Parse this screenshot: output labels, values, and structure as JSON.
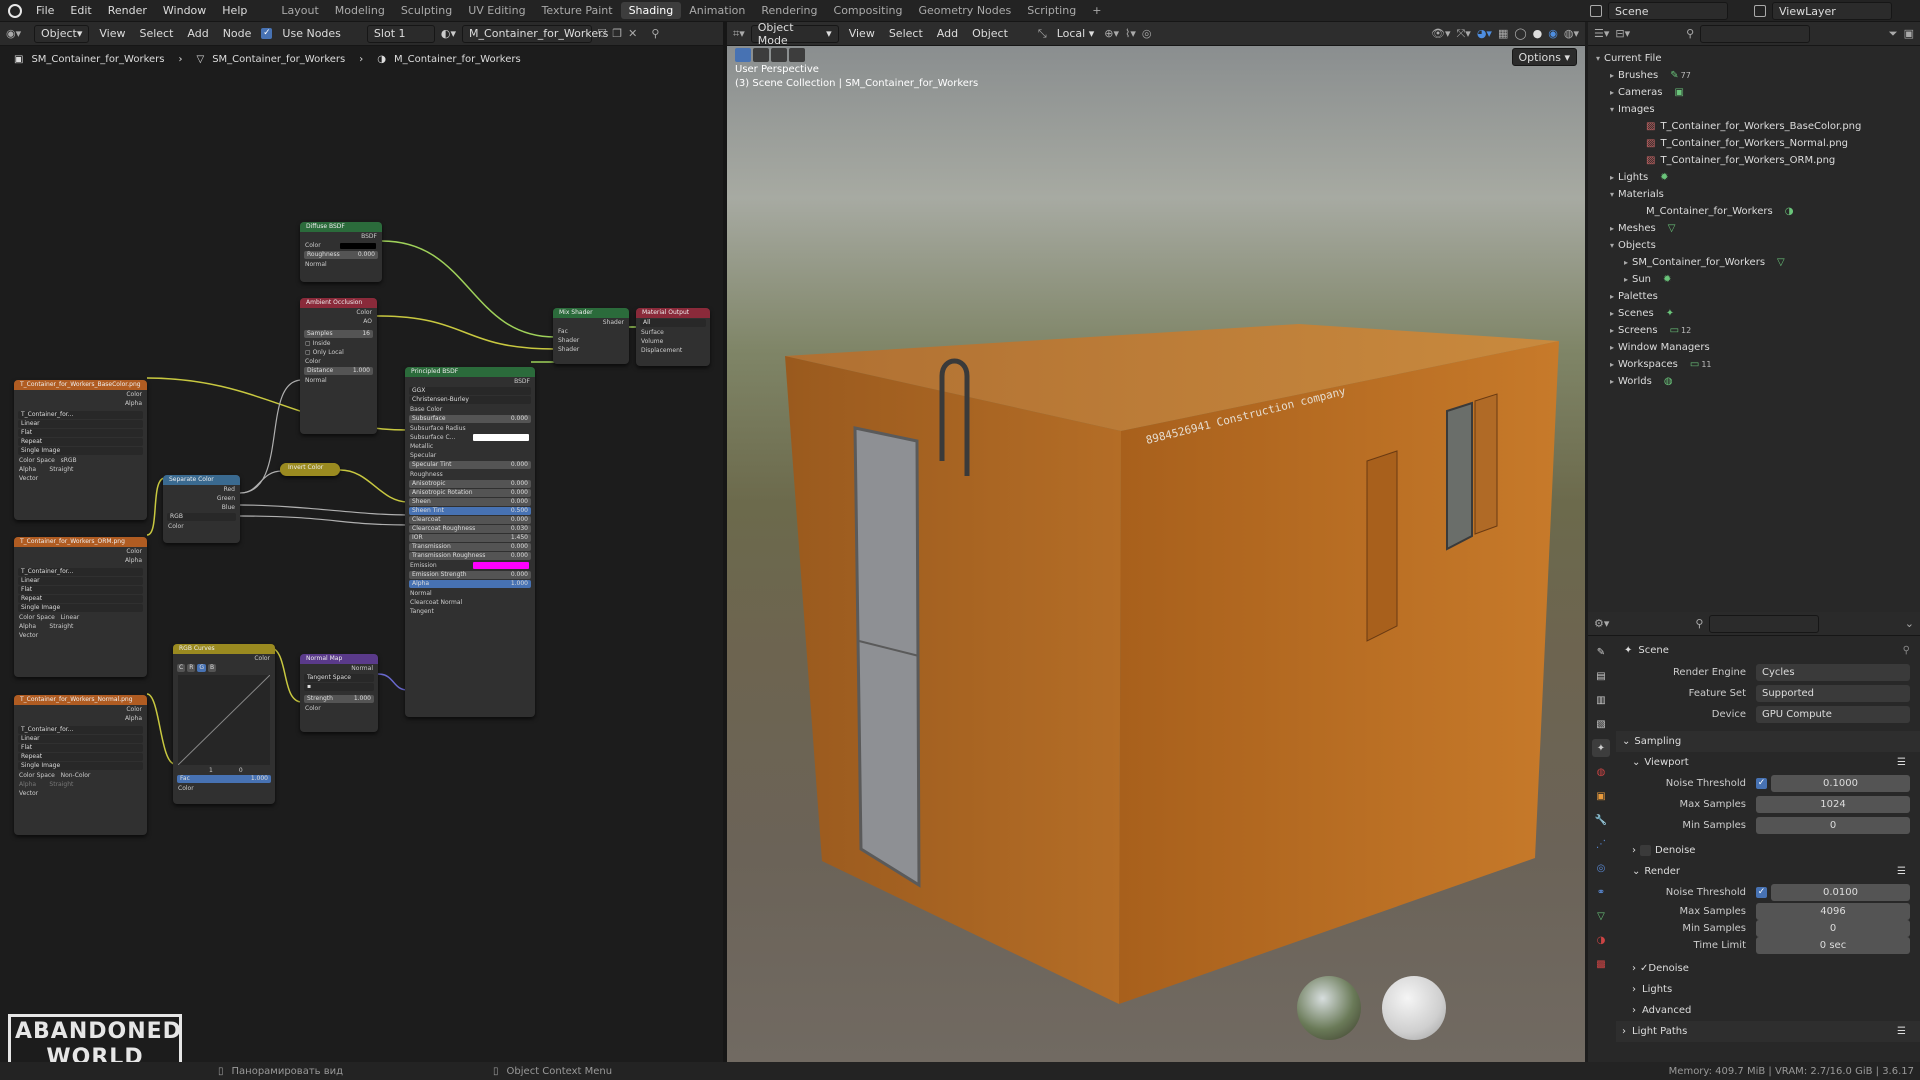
{
  "topbar": {
    "menus": [
      "File",
      "Edit",
      "Render",
      "Window",
      "Help"
    ],
    "workspaces": [
      "Layout",
      "Modeling",
      "Sculpting",
      "UV Editing",
      "Texture Paint",
      "Shading",
      "Animation",
      "Rendering",
      "Compositing",
      "Geometry Nodes",
      "Scripting"
    ],
    "active_workspace": "Shading",
    "add_tab": "+",
    "scene": "Scene",
    "view_layer": "ViewLayer"
  },
  "node_editor": {
    "header": {
      "mode": "Object",
      "menus": [
        "View",
        "Select",
        "Add",
        "Node"
      ],
      "use_nodes_label": "Use Nodes",
      "slot": "Slot 1",
      "material": "M_Container_for_Workers"
    },
    "breadcrumb": [
      "SM_Container_for_Workers",
      "SM_Container_for_Workers",
      "M_Container_for_Workers"
    ],
    "nodes": {
      "diffuse": {
        "title": "Diffuse BSDF",
        "out": "BSDF",
        "color": "Color",
        "roughness": "Roughness",
        "roughness_val": "0.000",
        "normal": "Normal"
      },
      "ao": {
        "title": "Ambient Occlusion",
        "color": "Color",
        "ao": "AO",
        "samples": "Samples",
        "samples_val": "16",
        "inside": "Inside",
        "only_local": "Only Local",
        "color_in": "Color",
        "distance": "Distance",
        "distance_val": "1.000",
        "normal": "Normal"
      },
      "mix": {
        "title": "Mix Shader",
        "out": "Shader",
        "fac": "Fac",
        "shader1": "Shader",
        "shader2": "Shader"
      },
      "output": {
        "title": "Material Output",
        "target": "All",
        "surface": "Surface",
        "volume": "Volume",
        "displacement": "Displacement"
      },
      "principled": {
        "title": "Principled BSDF",
        "out": "BSDF",
        "dist": "GGX",
        "sss": "Christensen-Burley",
        "rows": [
          "Base Color",
          "Subsurface",
          "Subsurface Radius",
          "Subsurface C...",
          "Metallic",
          "Specular",
          "Specular Tint",
          "Roughness",
          "Anisotropic",
          "Anisotropic Rotation",
          "Sheen",
          "Sheen Tint",
          "Clearcoat",
          "Clearcoat Roughness",
          "IOR",
          "Transmission",
          "Transmission Roughness",
          "Emission",
          "Emission Strength",
          "Alpha",
          "Normal",
          "Clearcoat Normal",
          "Tangent"
        ],
        "vals": {
          "Subsurface": "0.000",
          "Specular Tint": "0.000",
          "Anisotropic": "0.000",
          "Anisotropic Rotation": "0.000",
          "Sheen": "0.000",
          "Sheen Tint": "0.500",
          "Clearcoat": "0.000",
          "Clearcoat Roughness": "0.030",
          "IOR": "1.450",
          "Transmission": "0.000",
          "Transmission Roughness": "0.000",
          "Emission Strength": "0.000",
          "Alpha": "1.000"
        }
      },
      "tex_base": {
        "title": "T_Container_for_Workers_BaseColor.png",
        "color": "Color",
        "alpha": "Alpha",
        "img": "T_Container_for...",
        "interp": "Linear",
        "proj": "Flat",
        "ext": "Repeat",
        "src": "Single Image",
        "cs_label": "Color Space",
        "cs": "sRGB",
        "alpha_label": "Alpha",
        "alpha_mode": "Straight",
        "vector": "Vector"
      },
      "tex_orm": {
        "title": "T_Container_for_Workers_ORM.png",
        "color": "Color",
        "alpha": "Alpha",
        "img": "T_Container_for...",
        "interp": "Linear",
        "proj": "Flat",
        "ext": "Repeat",
        "src": "Single Image",
        "cs_label": "Color Space",
        "cs": "Linear",
        "alpha_label": "Alpha",
        "alpha_mode": "Straight",
        "vector": "Vector"
      },
      "tex_normal": {
        "title": "T_Container_for_Workers_Normal.png",
        "color": "Color",
        "alpha": "Alpha",
        "img": "T_Container_for...",
        "interp": "Linear",
        "proj": "Flat",
        "ext": "Repeat",
        "src": "Single Image",
        "cs_label": "Color Space",
        "cs": "Non-Color",
        "alpha_label": "Alpha",
        "alpha_mode": "Straight",
        "vector": "Vector"
      },
      "separate": {
        "title": "Separate Color",
        "red": "Red",
        "green": "Green",
        "blue": "Blue",
        "mode": "RGB",
        "color": "Color"
      },
      "invert": {
        "title": "Invert Color"
      },
      "curves": {
        "title": "RGB Curves",
        "color": "Color",
        "fac": "Fac",
        "fac_val": "1.000",
        "color_in": "Color",
        "tabs": [
          "C",
          "R",
          "G",
          "B"
        ],
        "v1": "1",
        "v2": "0"
      },
      "normalmap": {
        "title": "Normal Map",
        "normal": "Normal",
        "space": "Tangent Space",
        "strength": "Strength",
        "strength_val": "1.000",
        "color": "Color"
      }
    },
    "watermark": [
      "ABANDONED",
      "WORLD"
    ]
  },
  "viewport": {
    "header": {
      "mode": "Object Mode",
      "menus": [
        "View",
        "Select",
        "Add",
        "Object"
      ],
      "orientation": "Local"
    },
    "options": "Options",
    "overlay_line1": "User Perspective",
    "overlay_line2": "(3) Scene Collection | SM_Container_for_Workers",
    "stencil": "8984526941  Construction company"
  },
  "outliner": {
    "root": "Current File",
    "items": [
      {
        "label": "Brushes",
        "indent": 1,
        "arrow": "▸",
        "badge": "77"
      },
      {
        "label": "Cameras",
        "indent": 1,
        "arrow": "▸"
      },
      {
        "label": "Images",
        "indent": 1,
        "arrow": "▾"
      },
      {
        "label": "T_Container_for_Workers_BaseColor.png",
        "indent": 3,
        "arrow": ""
      },
      {
        "label": "T_Container_for_Workers_Normal.png",
        "indent": 3,
        "arrow": ""
      },
      {
        "label": "T_Container_for_Workers_ORM.png",
        "indent": 3,
        "arrow": ""
      },
      {
        "label": "Lights",
        "indent": 1,
        "arrow": "▸"
      },
      {
        "label": "Materials",
        "indent": 1,
        "arrow": "▾"
      },
      {
        "label": "M_Container_for_Workers",
        "indent": 3,
        "arrow": ""
      },
      {
        "label": "Meshes",
        "indent": 1,
        "arrow": "▸"
      },
      {
        "label": "Objects",
        "indent": 1,
        "arrow": "▾"
      },
      {
        "label": "SM_Container_for_Workers",
        "indent": 2,
        "arrow": "▸"
      },
      {
        "label": "Sun",
        "indent": 2,
        "arrow": "▸"
      },
      {
        "label": "Palettes",
        "indent": 1,
        "arrow": "▸"
      },
      {
        "label": "Scenes",
        "indent": 1,
        "arrow": "▸"
      },
      {
        "label": "Screens",
        "indent": 1,
        "arrow": "▸",
        "badge": "12"
      },
      {
        "label": "Window Managers",
        "indent": 1,
        "arrow": "▸"
      },
      {
        "label": "Workspaces",
        "indent": 1,
        "arrow": "▸",
        "badge": "11"
      },
      {
        "label": "Worlds",
        "indent": 1,
        "arrow": "▸"
      }
    ]
  },
  "properties": {
    "context": "Scene",
    "render_engine_label": "Render Engine",
    "render_engine": "Cycles",
    "feature_set_label": "Feature Set",
    "feature_set": "Supported",
    "device_label": "Device",
    "device": "GPU Compute",
    "sampling": "Sampling",
    "viewport": "Viewport",
    "vp_noise_label": "Noise Threshold",
    "vp_noise": "0.1000",
    "vp_max_label": "Max Samples",
    "vp_max": "1024",
    "vp_min_label": "Min Samples",
    "vp_min": "0",
    "denoise": "Denoise",
    "render": "Render",
    "r_noise_label": "Noise Threshold",
    "r_noise": "0.0100",
    "r_max_label": "Max Samples",
    "r_max": "4096",
    "r_min_label": "Min Samples",
    "r_min": "0",
    "r_time_label": "Time Limit",
    "r_time": "0 sec",
    "r_denoise": "Denoise",
    "lights": "Lights",
    "advanced": "Advanced",
    "light_paths": "Light Paths"
  },
  "status": {
    "left": "Панорамировать вид",
    "mid": "Object Context Menu",
    "right": "Memory: 409.7 MiB | VRAM: 2.7/16.0 GiB | 3.6.17"
  },
  "colors": {
    "accent": "#4772b3",
    "active_ws": "#3d3d3d",
    "container": "#c07a2a",
    "node_shader": "#2b6b3b",
    "node_texture": "#b05c22",
    "node_input": "#8a2a3a",
    "node_vector": "#5a3a8a",
    "node_converter": "#3a6a90",
    "node_color": "#9a8a20"
  }
}
